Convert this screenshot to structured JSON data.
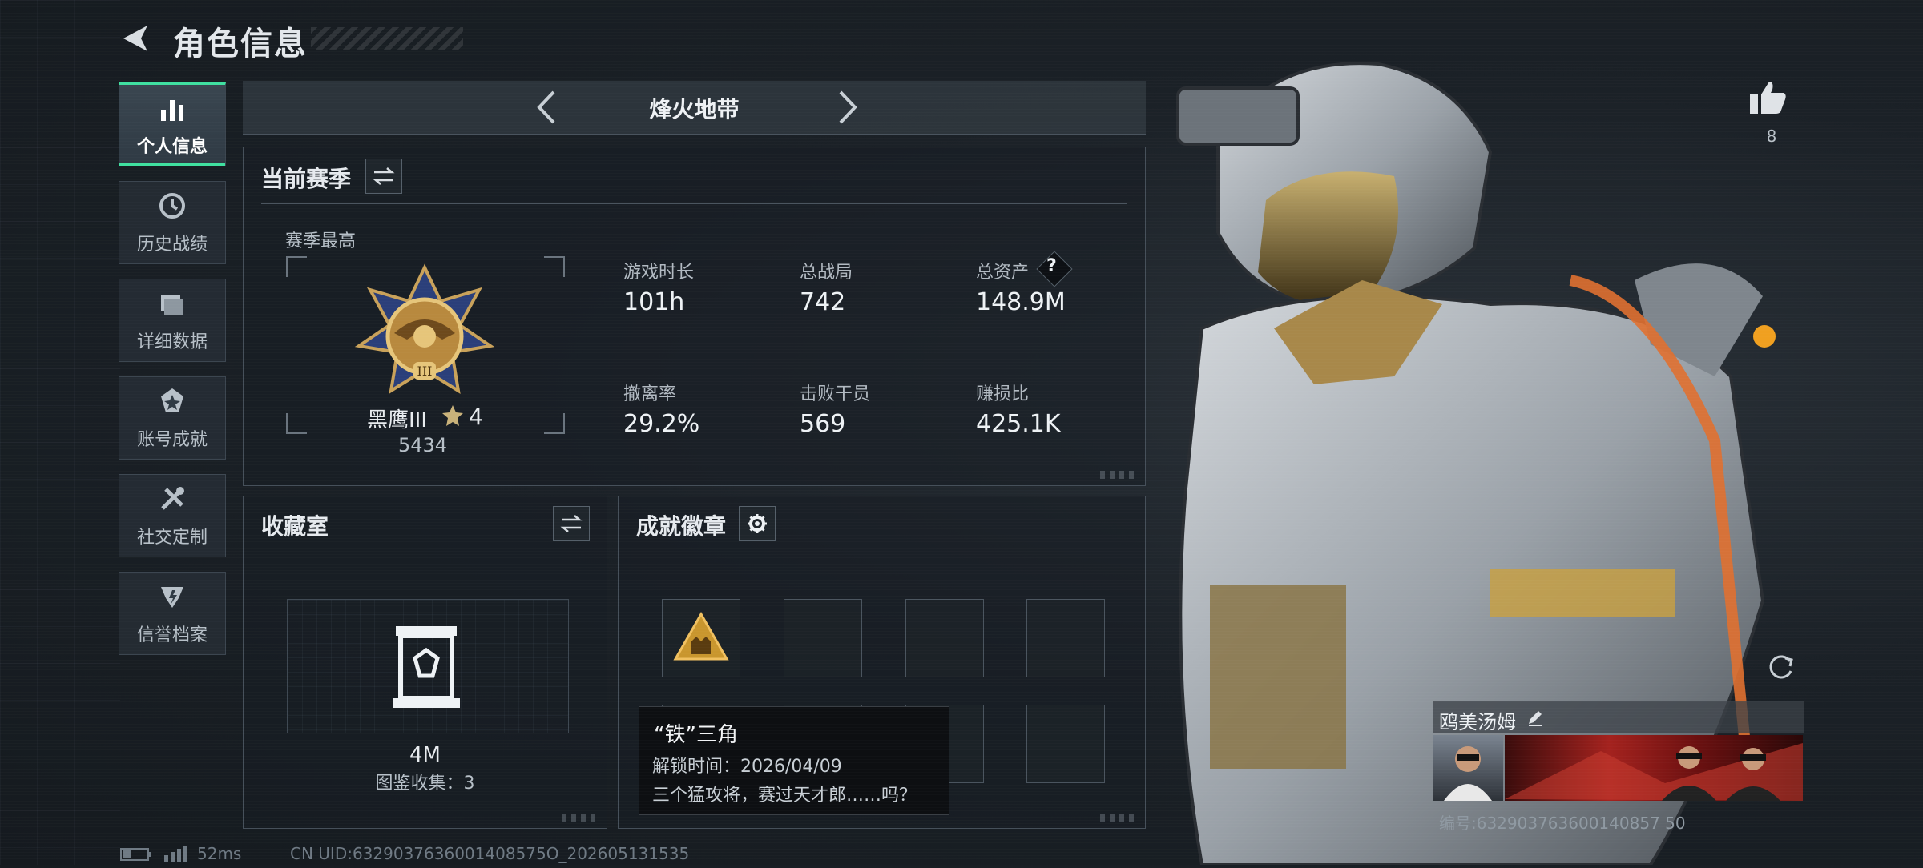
{
  "header": {
    "title": "角色信息"
  },
  "sidebar": {
    "items": [
      {
        "label": "个人信息",
        "icon": "bar-chart-icon",
        "active": true
      },
      {
        "label": "历史战绩",
        "icon": "history-icon",
        "active": false
      },
      {
        "label": "详细数据",
        "icon": "folder-icon",
        "active": false
      },
      {
        "label": "账号成就",
        "icon": "achievement-icon",
        "active": false
      },
      {
        "label": "社交定制",
        "icon": "tools-icon",
        "active": false
      },
      {
        "label": "信誉档案",
        "icon": "credit-icon",
        "active": false
      }
    ]
  },
  "mode": {
    "title": "烽火地带"
  },
  "season": {
    "title": "当前赛季",
    "best_label": "赛季最高",
    "rank_name": "黑鹰III",
    "rank_stars": "4",
    "rank_score": "5434",
    "stats": [
      {
        "label": "游戏时长",
        "value": "101h"
      },
      {
        "label": "总战局",
        "value": "742"
      },
      {
        "label": "总资产",
        "value": "148.9M",
        "help": "?"
      },
      {
        "label": "撤离率",
        "value": "29.2%"
      },
      {
        "label": "击败干员",
        "value": "569"
      },
      {
        "label": "赚损比",
        "value": "425.1K"
      }
    ]
  },
  "collection": {
    "title": "收藏室",
    "value": "4M",
    "sub": "图鉴收集：3"
  },
  "badges": {
    "title": "成就徽章",
    "tooltip": {
      "name": "“铁”三角",
      "unlock": "解锁时间：2026/04/09",
      "desc": "三个猛攻将，赛过天才郎……吗？"
    }
  },
  "likes": {
    "count": "8"
  },
  "player": {
    "nickname": "鸥美汤姆",
    "id_line": "编号:632903763600140857 50"
  },
  "footer": {
    "ping": "52ms",
    "uid": "CN UID:6329037636001408575O_202605131535"
  },
  "colors": {
    "accent": "#3fe0a0",
    "bg": "#1b2127",
    "banner": "#a4221e"
  }
}
